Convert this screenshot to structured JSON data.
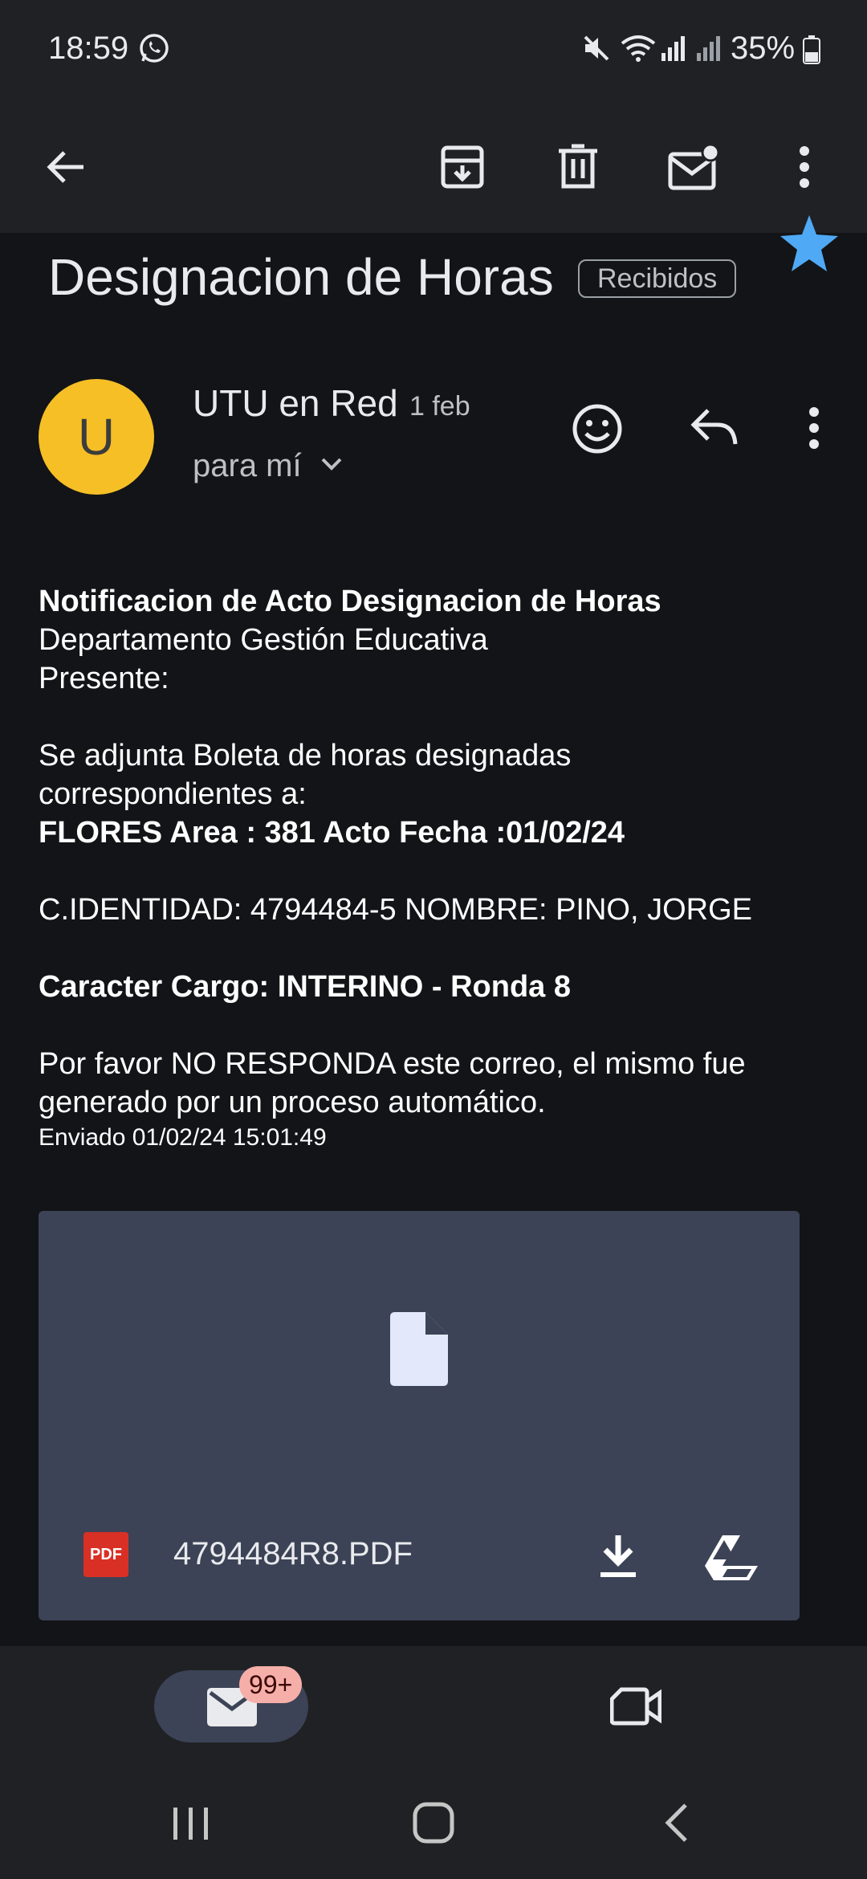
{
  "status_bar": {
    "time": "18:59",
    "battery": "35%",
    "icons": [
      "whatsapp-icon",
      "mute-icon",
      "wifi-icon",
      "signal-icon",
      "signal-icon",
      "battery-icon"
    ]
  },
  "toolbar": {
    "icons": [
      "back-arrow-icon",
      "archive-icon",
      "delete-icon",
      "mark-unread-icon",
      "more-vert-icon"
    ]
  },
  "email": {
    "subject": "Designacion de Horas",
    "label": "Recibidos",
    "starred": true,
    "sender": {
      "avatar_letter": "U",
      "name": "UTU en Red",
      "date": "1 feb",
      "recipient": "para mí"
    },
    "body": {
      "heading": "Notificacion de Acto Designacion de Horas",
      "department": "Departamento Gestión Educativa",
      "presente": "Presente:",
      "intro_1": "Se adjunta Boleta de horas designadas",
      "intro_2": "correspondientes a:",
      "area_line": "FLORES Area : 381 Acto Fecha :01/02/24",
      "id_line": "C.IDENTIDAD: 4794484-5 NOMBRE: PINO, JORGE",
      "cargo_line": "Caracter Cargo: INTERINO - Ronda 8",
      "notice_1": "Por favor NO RESPONDA este correo, el mismo fue",
      "notice_2": "generado por un proceso automático.",
      "sent": "Enviado 01/02/24 15:01:49"
    },
    "attachment": {
      "type_label": "PDF",
      "filename": "4794484R8.PDF"
    }
  },
  "bottom_nav": {
    "mail_badge": "99+"
  },
  "colors": {
    "background": "#131417",
    "bar": "#202124",
    "avatar": "#f6bf26",
    "star": "#4fa9f5",
    "attachment_bg": "#3c4356",
    "pdf_red": "#d93025",
    "badge": "#f6aea9"
  }
}
